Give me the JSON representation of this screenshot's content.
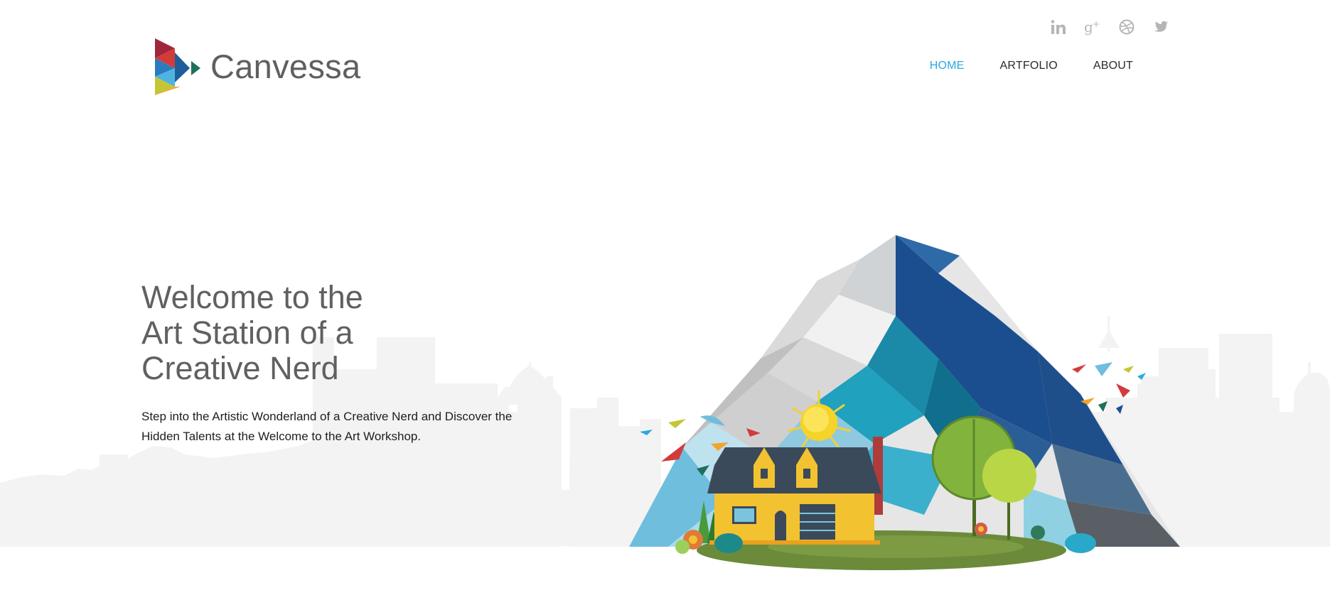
{
  "brand": {
    "name": "Canvessa",
    "accent": "#29a9e1",
    "text_color": "#5f5f5f"
  },
  "social": [
    {
      "icon": "linkedin-icon"
    },
    {
      "icon": "google-plus-icon"
    },
    {
      "icon": "dribbble-icon"
    },
    {
      "icon": "twitter-icon"
    }
  ],
  "nav": {
    "items": [
      {
        "label": "HOME",
        "active": true
      },
      {
        "label": "ARTFOLIO",
        "active": false
      },
      {
        "label": "ABOUT",
        "active": false
      }
    ]
  },
  "hero": {
    "title_lines": [
      "Welcome to the",
      "Art Station of a",
      "Creative Nerd"
    ],
    "description_lines": [
      "Step into the Artistic Wonderland of a Creative Nerd and Discover the",
      "Hidden Talents at the Welcome to the Art Workshop."
    ],
    "illustration": "mountain-house-illustration"
  }
}
